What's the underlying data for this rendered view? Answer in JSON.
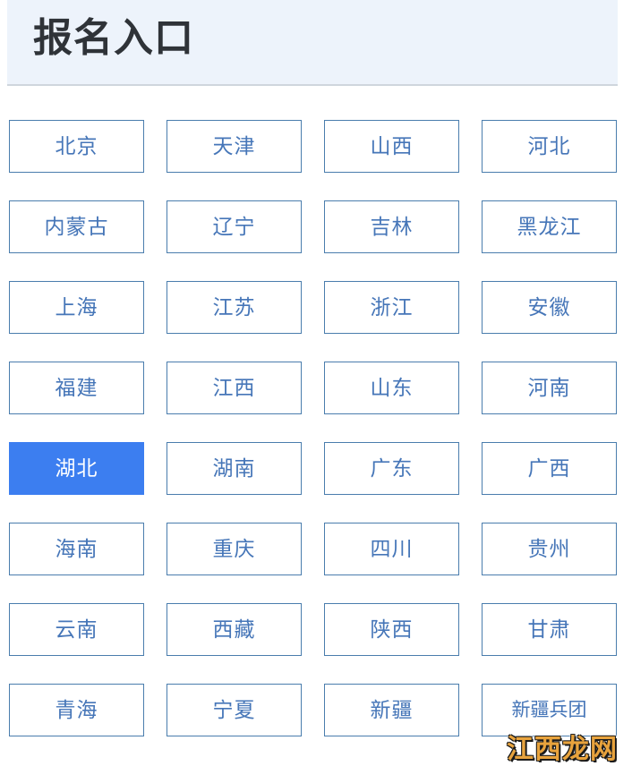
{
  "header": {
    "title": "报名入口"
  },
  "grid": {
    "active_index": 16,
    "accent_color": "#3c7ef0",
    "border_color": "#4a7dad",
    "text_color": "#4676b8",
    "buttons": [
      {
        "label": "北京"
      },
      {
        "label": "天津"
      },
      {
        "label": "山西"
      },
      {
        "label": "河北"
      },
      {
        "label": "内蒙古"
      },
      {
        "label": "辽宁"
      },
      {
        "label": "吉林"
      },
      {
        "label": "黑龙江"
      },
      {
        "label": "上海"
      },
      {
        "label": "江苏"
      },
      {
        "label": "浙江"
      },
      {
        "label": "安徽"
      },
      {
        "label": "福建"
      },
      {
        "label": "江西"
      },
      {
        "label": "山东"
      },
      {
        "label": "河南"
      },
      {
        "label": "湖北"
      },
      {
        "label": "湖南"
      },
      {
        "label": "广东"
      },
      {
        "label": "广西"
      },
      {
        "label": "海南"
      },
      {
        "label": "重庆"
      },
      {
        "label": "四川"
      },
      {
        "label": "贵州"
      },
      {
        "label": "云南"
      },
      {
        "label": "西藏"
      },
      {
        "label": "陕西"
      },
      {
        "label": "甘肃"
      },
      {
        "label": "青海"
      },
      {
        "label": "宁夏"
      },
      {
        "label": "新疆"
      },
      {
        "label": "新疆兵团"
      }
    ]
  },
  "watermark": {
    "text": "江西龙网",
    "color": "#e8a33d"
  }
}
